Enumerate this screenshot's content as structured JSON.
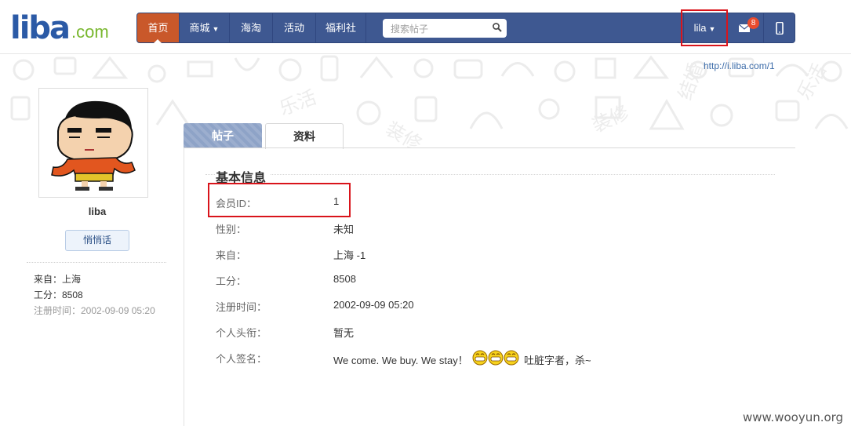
{
  "header": {
    "logo_main": "liba",
    "logo_suffix": ".com",
    "nav": [
      {
        "label": "首页",
        "active": true
      },
      {
        "label": "商城",
        "dropdown": true
      },
      {
        "label": "海淘"
      },
      {
        "label": "活动"
      },
      {
        "label": "福利社"
      }
    ],
    "search_placeholder": "搜索帖子",
    "user_label": "lila",
    "mail_badge": "8"
  },
  "profile_url": "http://i.liba.com/1",
  "sidebar": {
    "username": "liba",
    "message_button": "悄悄话",
    "from": "来自：上海",
    "points": "工分：8508",
    "registered": "注册时间：2002-09-09 05:20"
  },
  "tabs": [
    {
      "label": "帖子",
      "active": false
    },
    {
      "label": "资料",
      "active": true
    }
  ],
  "profile": {
    "section_title": "基本信息",
    "rows": [
      {
        "label": "会员ID：",
        "value": "1"
      },
      {
        "label": "性别：",
        "value": "未知"
      },
      {
        "label": "来自：",
        "value": "上海 -1"
      },
      {
        "label": "工分：",
        "value": "8508"
      },
      {
        "label": "注册时间：",
        "value": "2002-09-09 05:20"
      },
      {
        "label": "个人头衔：",
        "value": "暂无"
      },
      {
        "label": "个人签名：",
        "value_before": "We come. We buy. We stay！",
        "value_after": "吐脏字者，杀~"
      }
    ]
  },
  "watermark": "www.wooyun.org",
  "colors": {
    "nav_bg": "#3e5891",
    "nav_active": "#c9582a",
    "highlight_box": "#d9141b",
    "logo_blue": "#2b5aa6",
    "logo_green": "#79b72e"
  }
}
